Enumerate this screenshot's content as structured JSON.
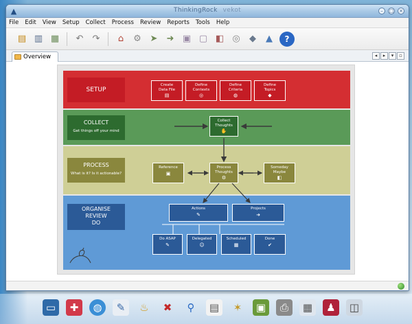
{
  "window": {
    "title": "ThinkingRock",
    "subtitle": "vekot"
  },
  "menu": [
    "File",
    "Edit",
    "View",
    "Setup",
    "Collect",
    "Process",
    "Review",
    "Reports",
    "Tools",
    "Help"
  ],
  "toolbar": {
    "icons": [
      "data-file-icon",
      "save-icon",
      "export-icon",
      "undo-icon",
      "redo-icon",
      "home-icon",
      "process-icon",
      "actions-icon",
      "projects-icon",
      "reference-icon",
      "someday-icon",
      "review-icon",
      "contexts-icon",
      "topics-icon",
      "help-icon"
    ]
  },
  "tabs": [
    {
      "label": "Overview"
    }
  ],
  "diagram": {
    "setup": {
      "label": "SETUP",
      "buttons": [
        {
          "label": "Create\nData File"
        },
        {
          "label": "Define\nContexts"
        },
        {
          "label": "Define\nCriteria"
        },
        {
          "label": "Define\nTopics"
        }
      ]
    },
    "collect": {
      "label": "COLLECT",
      "sublabel": "Get things off your mind",
      "button": {
        "label": "Collect\nThoughts"
      }
    },
    "process": {
      "label": "PROCESS",
      "sublabel": "What is it? Is it actionable?",
      "reference": {
        "label": "Reference"
      },
      "process_thoughts": {
        "label": "Process\nThoughts"
      },
      "someday": {
        "label": "Someday\nMaybe"
      }
    },
    "organise": {
      "label": "ORGANISE\nREVIEW\nDO",
      "actions": {
        "label": "Actions"
      },
      "projects": {
        "label": "Projects"
      },
      "do_asap": {
        "label": "Do ASAP"
      },
      "delegated": {
        "label": "Delegated"
      },
      "scheduled": {
        "label": "Scheduled"
      },
      "done": {
        "label": "Done"
      }
    }
  },
  "colors": {
    "setup": "#d42e32",
    "collect": "#5a9a58",
    "process": "#cfcf96",
    "organise": "#5f9ad6"
  }
}
